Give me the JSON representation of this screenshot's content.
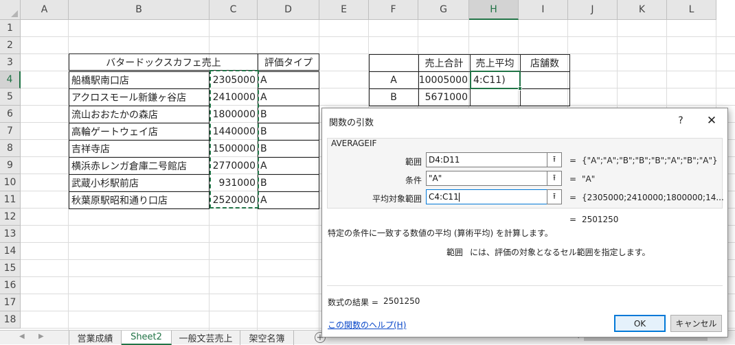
{
  "columns": [
    "A",
    "B",
    "C",
    "D",
    "E",
    "F",
    "G",
    "H",
    "I",
    "J",
    "K",
    "L"
  ],
  "active_column": "H",
  "rows": [
    "1",
    "2",
    "3",
    "4",
    "5",
    "6",
    "7",
    "8",
    "9",
    "10",
    "11",
    "12",
    "13",
    "14",
    "15",
    "16",
    "17",
    "18"
  ],
  "active_row": "4",
  "sales_table": {
    "header_name": "バタードックスカフェ売上",
    "header_type": "評価タイプ",
    "rows": [
      {
        "store": "船橋駅南口店",
        "amount": "2305000",
        "type": "A"
      },
      {
        "store": "アクロスモール新鎌ヶ谷店",
        "amount": "2410000",
        "type": "A"
      },
      {
        "store": "流山おおたかの森店",
        "amount": "1800000",
        "type": "B"
      },
      {
        "store": "高輪ゲートウェイ店",
        "amount": "1440000",
        "type": "B"
      },
      {
        "store": "吉祥寺店",
        "amount": "1500000",
        "type": "B"
      },
      {
        "store": "横浜赤レンガ倉庫二号館店",
        "amount": "2770000",
        "type": "A"
      },
      {
        "store": "武蔵小杉駅前店",
        "amount": "931000",
        "type": "B"
      },
      {
        "store": "秋葉原駅昭和通り口店",
        "amount": "2520000",
        "type": "A"
      }
    ]
  },
  "summary_table": {
    "headers": [
      "売上合計",
      "売上平均",
      "店舗数"
    ],
    "rows": [
      {
        "label": "A",
        "total": "10005000",
        "avg": "4:C11)"
      },
      {
        "label": "B",
        "total": "5671000",
        "avg": ""
      }
    ]
  },
  "dialog": {
    "title": "関数の引数",
    "help_symbol": "?",
    "close_symbol": "✕",
    "function_name": "AVERAGEIF",
    "args": [
      {
        "label": "範囲",
        "value": "D4:D11",
        "result": "{\"A\";\"A\";\"B\";\"B\";\"B\";\"A\";\"B\";\"A\"}"
      },
      {
        "label": "条件",
        "value": "\"A\"",
        "result": "\"A\""
      },
      {
        "label": "平均対象範囲",
        "value": "C4:C11",
        "result": "{2305000;2410000;1800000;14..."
      }
    ],
    "eq_sign": "=",
    "preview_result": "2501250",
    "description": "特定の条件に一致する数値の平均 (算術平均) を計算します。",
    "arg_help_name": "範囲",
    "arg_help_text": "には、評価の対象となるセル範囲を指定します。",
    "formula_result_label": "数式の結果 =",
    "formula_result_value": "2501250",
    "help_link": "この関数のヘルプ(H)",
    "ok_label": "OK",
    "cancel_label": "キャンセル"
  },
  "sheet_tabs": [
    "営業成績",
    "Sheet2",
    "一般文芸売上",
    "架空名簿"
  ],
  "active_sheet": "Sheet2",
  "colors": {
    "accent": "#217346",
    "link": "#0645c8",
    "focus": "#0078d7"
  }
}
